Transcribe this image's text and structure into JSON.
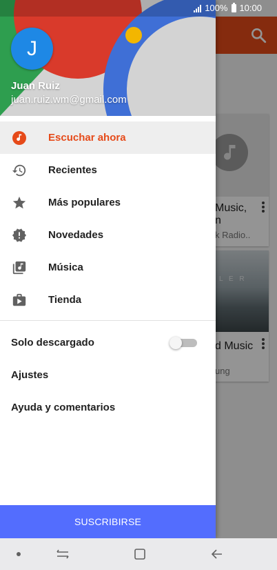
{
  "status_bar": {
    "battery": "100%",
    "time": "10:00"
  },
  "background": {
    "cards": [
      {
        "title": "Music,",
        "title2": "n",
        "subtitle": "k Radio.."
      },
      {
        "title": "d Music",
        "subtitle": "ung",
        "art_text": "L E R"
      }
    ]
  },
  "drawer": {
    "avatar_letter": "J",
    "user_name": "Juan Ruiz",
    "user_email": "juan.ruiz.wm@gmail.com",
    "nav_items": [
      {
        "label": "Escuchar ahora",
        "icon": "listen-now-icon",
        "active": true
      },
      {
        "label": "Recientes",
        "icon": "history-icon",
        "active": false
      },
      {
        "label": "Más populares",
        "icon": "star-icon",
        "active": false
      },
      {
        "label": "Novedades",
        "icon": "new-releases-icon",
        "active": false
      },
      {
        "label": "Música",
        "icon": "library-music-icon",
        "active": false
      },
      {
        "label": "Tienda",
        "icon": "play-store-icon",
        "active": false
      }
    ],
    "downloaded_only": {
      "label": "Solo descargado",
      "enabled": false
    },
    "settings_label": "Ajustes",
    "help_label": "Ayuda y comentarios",
    "subscribe_label": "SUSCRIBIRSE"
  },
  "colors": {
    "accent": "#e64a19",
    "subscribe": "#536dfe",
    "avatar": "#1e88e5"
  }
}
